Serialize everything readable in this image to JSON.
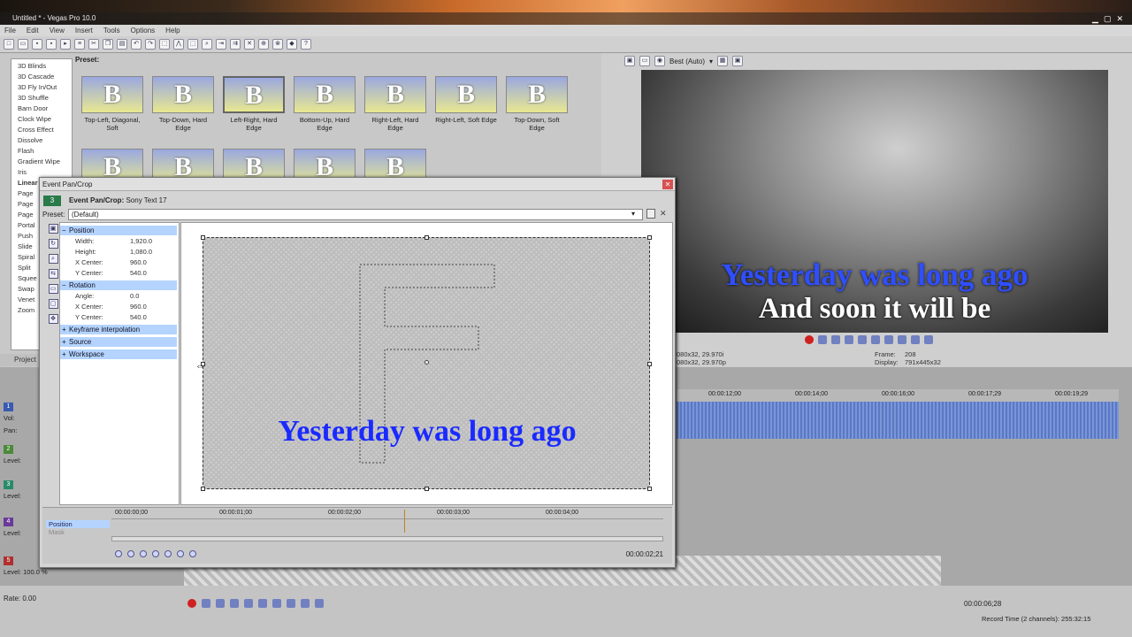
{
  "window": {
    "title": "Untitled * - Vegas Pro 10.0"
  },
  "menu": [
    "File",
    "Edit",
    "View",
    "Insert",
    "Tools",
    "Options",
    "Help"
  ],
  "fx_list": [
    "3D Blinds",
    "3D Cascade",
    "3D Fly In/Out",
    "3D Shuffle",
    "Barn Door",
    "Clock Wipe",
    "Cross Effect",
    "Dissolve",
    "Flash",
    "Gradient Wipe",
    "Iris",
    "Linear",
    "Page",
    "Page",
    "Page",
    "Portal",
    "Push",
    "Slide",
    "Spiral",
    "Split",
    "Squee",
    "Swap",
    "Venet",
    "Zoom"
  ],
  "preset_label": "Preset:",
  "presets": [
    {
      "glyph": "B",
      "label": "Top-Left, Diagonal, Soft"
    },
    {
      "glyph": "B",
      "label": "Top-Down, Hard Edge"
    },
    {
      "glyph": "B",
      "label": "Left-Right, Hard Edge"
    },
    {
      "glyph": "B",
      "label": "Bottom-Up, Hard Edge"
    },
    {
      "glyph": "B",
      "label": "Right-Left, Hard Edge"
    },
    {
      "glyph": "B",
      "label": "Right-Left, Soft Edge"
    },
    {
      "glyph": "B",
      "label": "Top-Down, Soft Edge"
    },
    {
      "glyph": "B",
      "label": ""
    },
    {
      "glyph": "B",
      "label": ""
    },
    {
      "glyph": "B",
      "label": ""
    },
    {
      "glyph": "B",
      "label": ""
    },
    {
      "glyph": "B",
      "label": ""
    }
  ],
  "project_tab": "Project",
  "preview": {
    "quality": "Best (Auto)",
    "line1": "Yesterday was long ago",
    "line2": "And soon it will be",
    "project_info": "080x32, 29.970i",
    "preview_info": "080x32, 29.970p",
    "frame_label": "Frame:",
    "frame": "208",
    "display_label": "Display:",
    "display": "791x445x32"
  },
  "timeline": {
    "ruler": [
      "00:00:12;00",
      "00:00:14;00",
      "00:00:16;00",
      "00:00:17;29",
      "00:00:19;29"
    ],
    "tracks": [
      {
        "num": "1",
        "color": "#3a5ab0",
        "lines": [
          "Vol:",
          "Pan:"
        ]
      },
      {
        "num": "2",
        "color": "#4a8a3a",
        "lines": [
          "Level:"
        ]
      },
      {
        "num": "3",
        "color": "#2a8a6a",
        "lines": [
          "Level:"
        ]
      },
      {
        "num": "4",
        "color": "#6a3a9a",
        "lines": [
          "Level:"
        ]
      },
      {
        "num": "5",
        "color": "#b03030",
        "lines": [
          "Level: 100.0 %"
        ]
      }
    ]
  },
  "bottom": {
    "rate": "Rate: 0.00",
    "time": "00:00:06;28",
    "status": "Record Time (2 channels): 255:32:15"
  },
  "dialog": {
    "title": "Event Pan/Crop",
    "header_bold": "Event Pan/Crop:",
    "header_rest": " Sony Text 17",
    "track_num": "3",
    "preset_label": "Preset:",
    "preset_value": "(Default)",
    "groups": {
      "position": "Position",
      "rotation": "Rotation",
      "keyframe": "Keyframe interpolation",
      "source": "Source",
      "workspace": "Workspace"
    },
    "position_props": [
      {
        "k": "Width:",
        "v": "1,920.0"
      },
      {
        "k": "Height:",
        "v": "1,080.0"
      },
      {
        "k": "X Center:",
        "v": "960.0"
      },
      {
        "k": "Y Center:",
        "v": "540.0"
      }
    ],
    "rotation_props": [
      {
        "k": "Angle:",
        "v": "0.0"
      },
      {
        "k": "X Center:",
        "v": "960.0"
      },
      {
        "k": "Y Center:",
        "v": "540.0"
      }
    ],
    "canvas_text": "Yesterday was long ago",
    "kf_ruler": [
      "00:00:00;00",
      "00:00:01;00",
      "00:00:02;00",
      "00:00:03;00",
      "00:00:04;00"
    ],
    "kf_track": "Position",
    "kf_track2": "Mask",
    "kf_time": "00:00:02;21"
  }
}
